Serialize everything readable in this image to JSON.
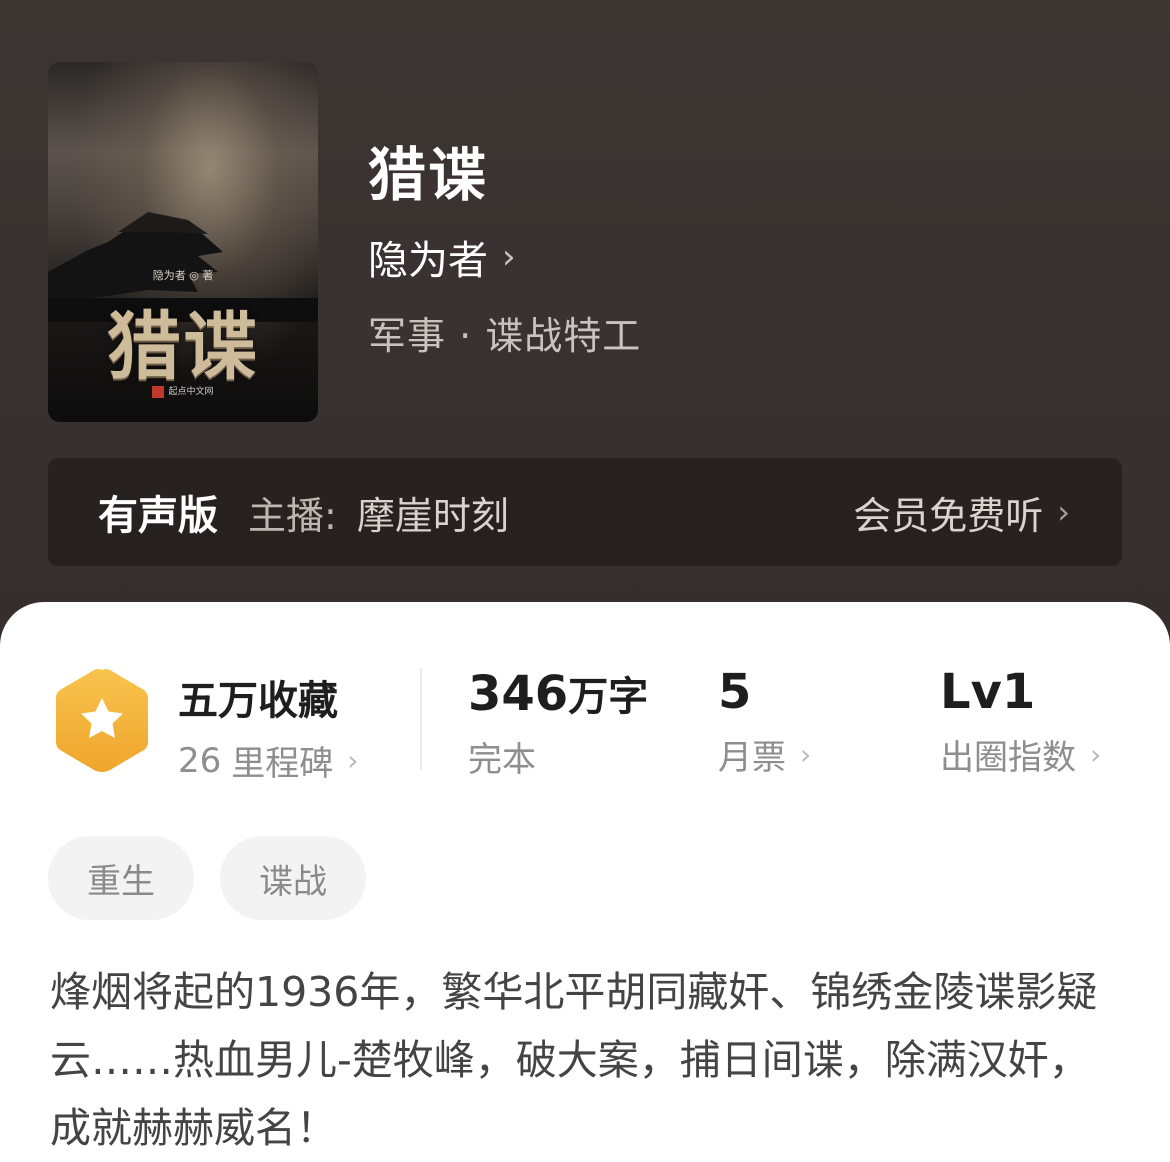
{
  "cover": {
    "author_text": "隐为者 ◎ 著",
    "title_text": "猎谍",
    "publisher_text": "起点中文网"
  },
  "book": {
    "title": "猎谍",
    "author": "隐为者",
    "author_chevron": "›",
    "genre": "军事 · 谍战特工"
  },
  "audio": {
    "label": "有声版",
    "narrator_prefix": "主播:",
    "narrator_name": "摩崖时刻",
    "action_label": "会员免费听",
    "action_chevron": "›"
  },
  "stats": {
    "badge_icon": "star-hexagon-icon",
    "badge_color": "#f5b53a",
    "favorites": {
      "main": "五万收藏",
      "sub_number": "26",
      "sub_label": "里程碑"
    },
    "words": {
      "number": "346",
      "unit": "万字",
      "sub": "完本"
    },
    "monthly": {
      "number": "5",
      "sub": "月票"
    },
    "level": {
      "number": "Lv1",
      "sub": "出圈指数"
    },
    "chevron": "›"
  },
  "tags": [
    "重生",
    "谍战"
  ],
  "description": "烽烟将起的1936年，繁华北平胡同藏奸、锦绣金陵谍影疑云……热血男儿-楚牧峰，破大案，捕日间谍，除满汉奸，成就赫赫威名！"
}
